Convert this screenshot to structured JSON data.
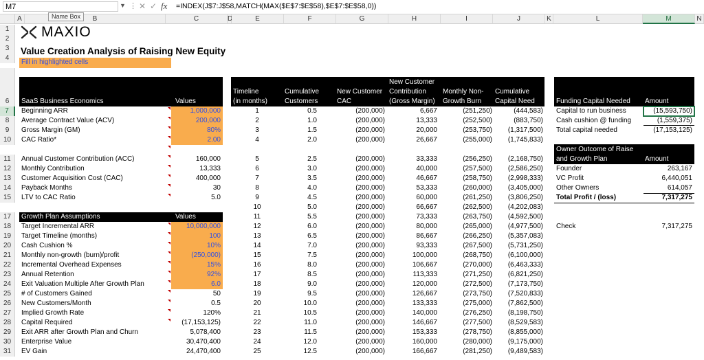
{
  "formula_bar": {
    "name_box": "M7",
    "formula": "=INDEX(J$7:J$58,MATCH(MAX($E$7:$E$58),$E$7:$E$58,0))",
    "tooltip": "Name Box"
  },
  "columns": [
    "A",
    "B",
    "C",
    "D",
    "E",
    "F",
    "G",
    "H",
    "I",
    "J",
    "K",
    "L",
    "M",
    "N"
  ],
  "rows": [
    "1",
    "2",
    "3",
    "4",
    "6",
    "7",
    "8",
    "9",
    "10",
    "11",
    "12",
    "13",
    "14",
    "15",
    "17",
    "18",
    "19",
    "20",
    "21",
    "22",
    "23",
    "24",
    "25",
    "26",
    "27",
    "28",
    "29",
    "30",
    "31"
  ],
  "logo": {
    "text": "MAXIO"
  },
  "title": "Value Creation Analysis of Raising New Equity",
  "fill_note": "Fill in highlighted cells",
  "saas": {
    "header_label": "SaaS Business Economics",
    "header_values": "Values",
    "items": [
      {
        "label": "Beginning ARR",
        "value": "1,000,000"
      },
      {
        "label": "Average Contract Value (ACV)",
        "value": "200,000"
      },
      {
        "label": "Gross Margin (GM)",
        "value": "80%"
      },
      {
        "label": "CAC Ratio*",
        "value": "2.00"
      }
    ],
    "calc": [
      {
        "label": "Annual Customer Contribution (ACC)",
        "value": "160,000"
      },
      {
        "label": "Monthly Contribution",
        "value": "13,333"
      },
      {
        "label": "Customer Acquisition Cost (CAC)",
        "value": "400,000"
      },
      {
        "label": "Payback Months",
        "value": "30"
      },
      {
        "label": "LTV to CAC Ratio",
        "value": "5.0"
      }
    ]
  },
  "growth": {
    "header_label": "Growth Plan Assumptions",
    "header_values": "Values",
    "inputs": [
      {
        "label": "Target Incremental ARR",
        "value": "10,000,000"
      },
      {
        "label": "Target Timeline (months)",
        "value": "100"
      },
      {
        "label": "Cash Cushion %",
        "value": "10%"
      },
      {
        "label": "Monthly non-growth (burn)/profit",
        "value": "(250,000)"
      },
      {
        "label": "Incremental Overhead Expenses",
        "value": "15%"
      },
      {
        "label": "Annual Retention",
        "value": "92%"
      },
      {
        "label": "Exit Valuation Multiple After Growth Plan",
        "value": "6.0"
      }
    ],
    "calc": [
      {
        "label": "# of Customers Gained",
        "value": "50"
      },
      {
        "label": "New Customers/Month",
        "value": "0.5"
      },
      {
        "label": "Implied Growth Rate",
        "value": "120%"
      },
      {
        "label": "Capital Required",
        "value": "(17,153,125)"
      },
      {
        "label": "Exit ARR after Growth Plan and Churn",
        "value": "5,078,400"
      },
      {
        "label": "Enterprise Value",
        "value": "30,470,400"
      },
      {
        "label": "EV Gain",
        "value": "24,470,400"
      }
    ]
  },
  "timeline": {
    "headers": {
      "timeline": [
        "Timeline",
        "(in months)"
      ],
      "cum_customers": [
        "Cumulative",
        "Customers"
      ],
      "new_cac": [
        "New Customer",
        "CAC"
      ],
      "new_contrib": [
        "New Customer",
        "Contribution",
        "(Gross Margin)"
      ],
      "burn": [
        "Monthly Non-",
        "Growth Burn"
      ],
      "cum_cap": [
        "Cumulative",
        "Capital Need"
      ]
    },
    "rows": [
      {
        "m": "1",
        "cc": "0.5",
        "cac": "(200,000)",
        "contrib": "6,667",
        "burn": "(251,250)",
        "cap": "(444,583)"
      },
      {
        "m": "2",
        "cc": "1.0",
        "cac": "(200,000)",
        "contrib": "13,333",
        "burn": "(252,500)",
        "cap": "(883,750)"
      },
      {
        "m": "3",
        "cc": "1.5",
        "cac": "(200,000)",
        "contrib": "20,000",
        "burn": "(253,750)",
        "cap": "(1,317,500)"
      },
      {
        "m": "4",
        "cc": "2.0",
        "cac": "(200,000)",
        "contrib": "26,667",
        "burn": "(255,000)",
        "cap": "(1,745,833)"
      },
      {
        "m": "5",
        "cc": "2.5",
        "cac": "(200,000)",
        "contrib": "33,333",
        "burn": "(256,250)",
        "cap": "(2,168,750)"
      },
      {
        "m": "6",
        "cc": "3.0",
        "cac": "(200,000)",
        "contrib": "40,000",
        "burn": "(257,500)",
        "cap": "(2,586,250)"
      },
      {
        "m": "7",
        "cc": "3.5",
        "cac": "(200,000)",
        "contrib": "46,667",
        "burn": "(258,750)",
        "cap": "(2,998,333)"
      },
      {
        "m": "8",
        "cc": "4.0",
        "cac": "(200,000)",
        "contrib": "53,333",
        "burn": "(260,000)",
        "cap": "(3,405,000)"
      },
      {
        "m": "9",
        "cc": "4.5",
        "cac": "(200,000)",
        "contrib": "60,000",
        "burn": "(261,250)",
        "cap": "(3,806,250)"
      },
      {
        "m": "10",
        "cc": "5.0",
        "cac": "(200,000)",
        "contrib": "66,667",
        "burn": "(262,500)",
        "cap": "(4,202,083)"
      },
      {
        "m": "11",
        "cc": "5.5",
        "cac": "(200,000)",
        "contrib": "73,333",
        "burn": "(263,750)",
        "cap": "(4,592,500)"
      },
      {
        "m": "12",
        "cc": "6.0",
        "cac": "(200,000)",
        "contrib": "80,000",
        "burn": "(265,000)",
        "cap": "(4,977,500)"
      },
      {
        "m": "13",
        "cc": "6.5",
        "cac": "(200,000)",
        "contrib": "86,667",
        "burn": "(266,250)",
        "cap": "(5,357,083)"
      },
      {
        "m": "14",
        "cc": "7.0",
        "cac": "(200,000)",
        "contrib": "93,333",
        "burn": "(267,500)",
        "cap": "(5,731,250)"
      },
      {
        "m": "15",
        "cc": "7.5",
        "cac": "(200,000)",
        "contrib": "100,000",
        "burn": "(268,750)",
        "cap": "(6,100,000)"
      },
      {
        "m": "16",
        "cc": "8.0",
        "cac": "(200,000)",
        "contrib": "106,667",
        "burn": "(270,000)",
        "cap": "(6,463,333)"
      },
      {
        "m": "17",
        "cc": "8.5",
        "cac": "(200,000)",
        "contrib": "113,333",
        "burn": "(271,250)",
        "cap": "(6,821,250)"
      },
      {
        "m": "18",
        "cc": "9.0",
        "cac": "(200,000)",
        "contrib": "120,000",
        "burn": "(272,500)",
        "cap": "(7,173,750)"
      },
      {
        "m": "19",
        "cc": "9.5",
        "cac": "(200,000)",
        "contrib": "126,667",
        "burn": "(273,750)",
        "cap": "(7,520,833)"
      },
      {
        "m": "20",
        "cc": "10.0",
        "cac": "(200,000)",
        "contrib": "133,333",
        "burn": "(275,000)",
        "cap": "(7,862,500)"
      },
      {
        "m": "21",
        "cc": "10.5",
        "cac": "(200,000)",
        "contrib": "140,000",
        "burn": "(276,250)",
        "cap": "(8,198,750)"
      },
      {
        "m": "22",
        "cc": "11.0",
        "cac": "(200,000)",
        "contrib": "146,667",
        "burn": "(277,500)",
        "cap": "(8,529,583)"
      },
      {
        "m": "23",
        "cc": "11.5",
        "cac": "(200,000)",
        "contrib": "153,333",
        "burn": "(278,750)",
        "cap": "(8,855,000)"
      },
      {
        "m": "24",
        "cc": "12.0",
        "cac": "(200,000)",
        "contrib": "160,000",
        "burn": "(280,000)",
        "cap": "(9,175,000)"
      },
      {
        "m": "25",
        "cc": "12.5",
        "cac": "(200,000)",
        "contrib": "166,667",
        "burn": "(281,250)",
        "cap": "(9,489,583)"
      }
    ]
  },
  "funding": {
    "header_label": "Funding Capital Needed",
    "header_amount": "Amount",
    "items": [
      {
        "label": "Capital to run business",
        "value": "(15,593,750)"
      },
      {
        "label": "Cash cushion @ funding",
        "value": "(1,559,375)"
      },
      {
        "label": "Total capital needed",
        "value": "(17,153,125)"
      }
    ]
  },
  "owner": {
    "header_label": [
      "Owner Outcome of Raise",
      "and Growth Plan"
    ],
    "header_amount": "Amount",
    "items": [
      {
        "label": "Founder",
        "value": "263,167"
      },
      {
        "label": "VC Profit",
        "value": "6,440,051"
      },
      {
        "label": "Other Owners",
        "value": "614,057"
      }
    ],
    "total": {
      "label": "Total Profit / (loss)",
      "value": "7,317,275"
    }
  },
  "check": {
    "label": "Check",
    "value": "7,317,275"
  }
}
